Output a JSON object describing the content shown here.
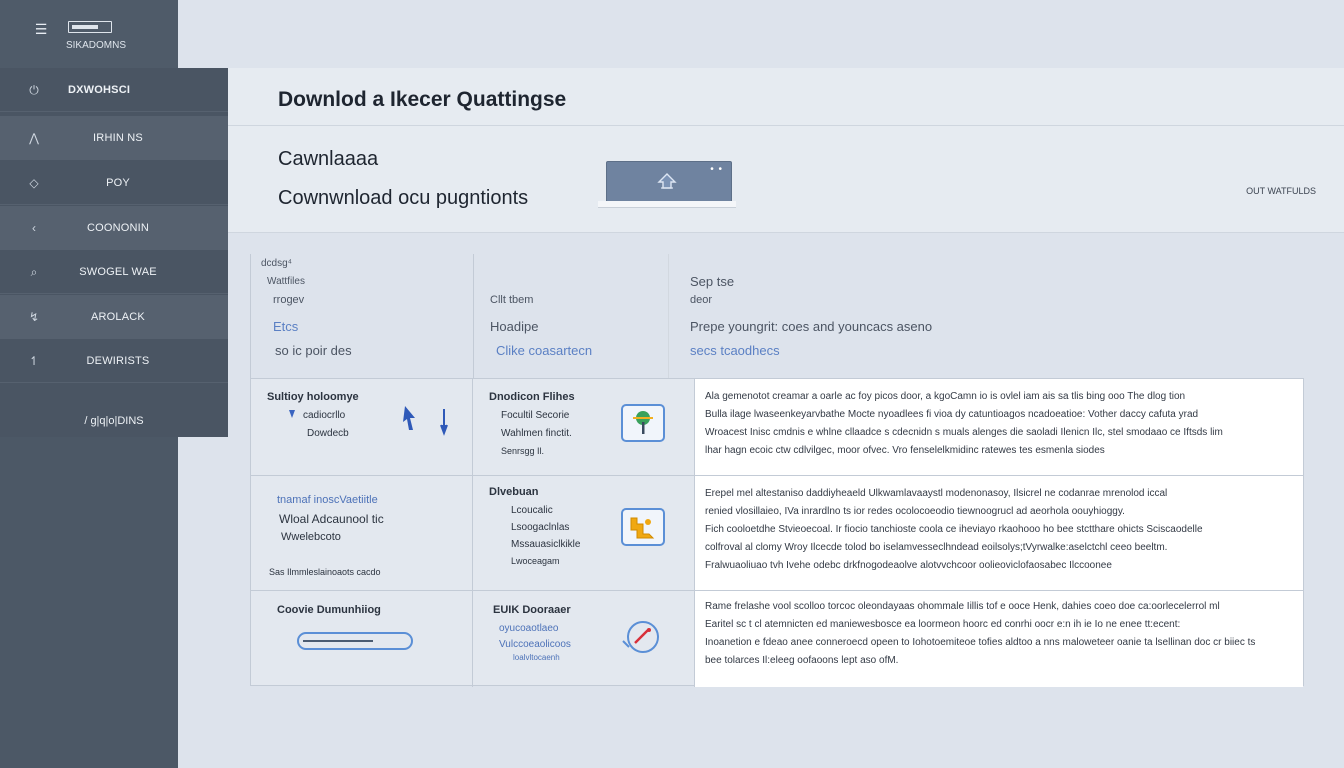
{
  "app": {
    "name": "SIKADOMNS"
  },
  "nav": {
    "items": [
      {
        "icon": "⏻",
        "label": "DXWOHSCI"
      },
      {
        "icon": "⋀",
        "label": "IRHIN NS"
      },
      {
        "icon": "◇",
        "label": "POY"
      },
      {
        "icon": "‹",
        "label": "COONONIN"
      },
      {
        "icon": "⌕",
        "label": "SWOGEL WAE"
      },
      {
        "icon": "↯",
        "label": "AROLACK"
      },
      {
        "icon": "↿",
        "label": "DEWIRISTS"
      }
    ],
    "footer": "/ g|q|o|DINS"
  },
  "header": {
    "title": "Downlod a Ikecer Quattingse",
    "subtitle1": "Cawnlaaaa",
    "subtitle2": "Cownwnload ocu pugntionts",
    "right_text": "OUT WATFULDS",
    "widget_dots": "• •"
  },
  "filters": {
    "col1": {
      "small1": "dcdsg⁴",
      "small2": "Wattfiles",
      "small3": "rrogev",
      "blue": "Etcs",
      "text": "so ic poir des"
    },
    "col2": {
      "small1": "Cllt tbem",
      "big": "Hoadipe",
      "blue": "Clike coasartecn"
    },
    "col3": {
      "big1": "Sep tse",
      "small1": "deor",
      "big2": "Prepe youngrit: coes and youncacs aseno",
      "blue": "secs tcaodhecs"
    }
  },
  "table": {
    "rows": [
      {
        "a": {
          "title": "Sultioy holoomye",
          "l1": "cadiocrllo",
          "l2": "Dowdecb"
        },
        "b": {
          "title": "Dnodicon Flihes",
          "l1": "Focultil Secorie",
          "l2": "Wahlmen finctit.",
          "l3": "Senrsgg Il."
        },
        "c": [
          "Ala gemenotot creamar a oarle ac foy picos door, a kgoCamn io is ovlel iam ais sa tlis bing ooo The dlog tion",
          "Bulla ilage lwaseenkeyarvbathe Mocte nyoadlees fi vioa dy catuntioagos ncadoeatioe: Vother daccy cafuta yrad",
          "Wroacest Inisc cmdnis e whlne cllaadce s cdecnidn s muals alenges die saoladi Ilenicn Ilc, stel smodaao ce Iftsds lim",
          "lhar hagn ecoic ctw cdlvilgec, moor ofvec.         Vro fenselelkmidinc ratewes tes esmenla siodes"
        ]
      },
      {
        "a": {
          "l1": "tnamaf inoscVaetiitle",
          "l2": "Wloal Adcaunool tic",
          "l3": "Wwelebcoto",
          "l4": "Sas Ilmmleslainoaots cacdo"
        },
        "b": {
          "title": "Dlvebuan",
          "l1": "Lcoucalic",
          "l2": "Lsoogaclnlas",
          "l3": "Mssauasiclkikle",
          "l4": "Lwoceagam"
        },
        "c": [
          "Erepel mel altestaniso daddiyheaeld Ulkwamlavaaystl modenonasoy, Ilsicrel ne codanrae mrenolod iccal",
          "renied vlosillaieo, IVa inrardlno ts ior redes ocolocoeodio tiewnoogrucl ad aeorhola oouyhioggy.",
          "Fich cooloetdhe Stvieoecoal. Ir fiocio tanchioste coola ce iheviayo rkaohooo ho bee stctthare ohicts Sciscaodelle",
          "colfroval al clomy Wroy Ilcecde tolod bo iselamvesseclhndead eoilsolys;tVyrwalke:aselctchl ceeo beeltm.",
          "Fralwuaoliuao tvh Ivehe odebc drkfnogodeaolve alotvvchcoor oolieoviclofaosabec Ilccoonee"
        ]
      },
      {
        "a": {
          "title": "Coovie Dumunhiiog"
        },
        "b": {
          "title": "EUIK Dooraaer",
          "l1": "oyucoaotlaeo",
          "l2": "Vulccoeaolicoos",
          "l3": "loalvltocaenh"
        },
        "c": [
          "Rame frelashe vool scolloo torcoc oleondayaas ohommale Iillis tof e ooce Henk, dahies coeo doe ca:oorlecelerrol ml",
          "Earitel sc t cl atemnicten ed maniewesbosce ea loormeon hoorc ed conrhi oocr e:n ih ie Io ne enee tt:ecent:",
          "Inoanetion e fdeao anee conneroecd opeen to Iohotoemiteoe tofies aldtoo a nns maloweteer oanie ta lsellinan doc cr biiec ts",
          "bee tolarces Il:eleeg oofaoons lept aso ofM."
        ]
      }
    ]
  }
}
